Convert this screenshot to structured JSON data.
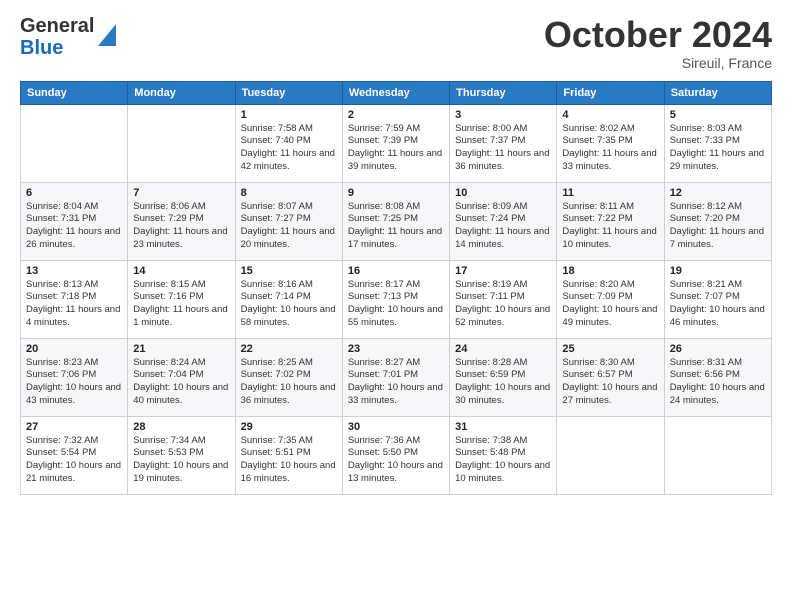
{
  "header": {
    "logo_line1": "General",
    "logo_line2": "Blue",
    "month": "October 2024",
    "location": "Sireuil, France"
  },
  "weekdays": [
    "Sunday",
    "Monday",
    "Tuesday",
    "Wednesday",
    "Thursday",
    "Friday",
    "Saturday"
  ],
  "weeks": [
    [
      {
        "day": "",
        "info": ""
      },
      {
        "day": "",
        "info": ""
      },
      {
        "day": "1",
        "info": "Sunrise: 7:58 AM\nSunset: 7:40 PM\nDaylight: 11 hours and 42 minutes."
      },
      {
        "day": "2",
        "info": "Sunrise: 7:59 AM\nSunset: 7:39 PM\nDaylight: 11 hours and 39 minutes."
      },
      {
        "day": "3",
        "info": "Sunrise: 8:00 AM\nSunset: 7:37 PM\nDaylight: 11 hours and 36 minutes."
      },
      {
        "day": "4",
        "info": "Sunrise: 8:02 AM\nSunset: 7:35 PM\nDaylight: 11 hours and 33 minutes."
      },
      {
        "day": "5",
        "info": "Sunrise: 8:03 AM\nSunset: 7:33 PM\nDaylight: 11 hours and 29 minutes."
      }
    ],
    [
      {
        "day": "6",
        "info": "Sunrise: 8:04 AM\nSunset: 7:31 PM\nDaylight: 11 hours and 26 minutes."
      },
      {
        "day": "7",
        "info": "Sunrise: 8:06 AM\nSunset: 7:29 PM\nDaylight: 11 hours and 23 minutes."
      },
      {
        "day": "8",
        "info": "Sunrise: 8:07 AM\nSunset: 7:27 PM\nDaylight: 11 hours and 20 minutes."
      },
      {
        "day": "9",
        "info": "Sunrise: 8:08 AM\nSunset: 7:25 PM\nDaylight: 11 hours and 17 minutes."
      },
      {
        "day": "10",
        "info": "Sunrise: 8:09 AM\nSunset: 7:24 PM\nDaylight: 11 hours and 14 minutes."
      },
      {
        "day": "11",
        "info": "Sunrise: 8:11 AM\nSunset: 7:22 PM\nDaylight: 11 hours and 10 minutes."
      },
      {
        "day": "12",
        "info": "Sunrise: 8:12 AM\nSunset: 7:20 PM\nDaylight: 11 hours and 7 minutes."
      }
    ],
    [
      {
        "day": "13",
        "info": "Sunrise: 8:13 AM\nSunset: 7:18 PM\nDaylight: 11 hours and 4 minutes."
      },
      {
        "day": "14",
        "info": "Sunrise: 8:15 AM\nSunset: 7:16 PM\nDaylight: 11 hours and 1 minute."
      },
      {
        "day": "15",
        "info": "Sunrise: 8:16 AM\nSunset: 7:14 PM\nDaylight: 10 hours and 58 minutes."
      },
      {
        "day": "16",
        "info": "Sunrise: 8:17 AM\nSunset: 7:13 PM\nDaylight: 10 hours and 55 minutes."
      },
      {
        "day": "17",
        "info": "Sunrise: 8:19 AM\nSunset: 7:11 PM\nDaylight: 10 hours and 52 minutes."
      },
      {
        "day": "18",
        "info": "Sunrise: 8:20 AM\nSunset: 7:09 PM\nDaylight: 10 hours and 49 minutes."
      },
      {
        "day": "19",
        "info": "Sunrise: 8:21 AM\nSunset: 7:07 PM\nDaylight: 10 hours and 46 minutes."
      }
    ],
    [
      {
        "day": "20",
        "info": "Sunrise: 8:23 AM\nSunset: 7:06 PM\nDaylight: 10 hours and 43 minutes."
      },
      {
        "day": "21",
        "info": "Sunrise: 8:24 AM\nSunset: 7:04 PM\nDaylight: 10 hours and 40 minutes."
      },
      {
        "day": "22",
        "info": "Sunrise: 8:25 AM\nSunset: 7:02 PM\nDaylight: 10 hours and 36 minutes."
      },
      {
        "day": "23",
        "info": "Sunrise: 8:27 AM\nSunset: 7:01 PM\nDaylight: 10 hours and 33 minutes."
      },
      {
        "day": "24",
        "info": "Sunrise: 8:28 AM\nSunset: 6:59 PM\nDaylight: 10 hours and 30 minutes."
      },
      {
        "day": "25",
        "info": "Sunrise: 8:30 AM\nSunset: 6:57 PM\nDaylight: 10 hours and 27 minutes."
      },
      {
        "day": "26",
        "info": "Sunrise: 8:31 AM\nSunset: 6:56 PM\nDaylight: 10 hours and 24 minutes."
      }
    ],
    [
      {
        "day": "27",
        "info": "Sunrise: 7:32 AM\nSunset: 5:54 PM\nDaylight: 10 hours and 21 minutes."
      },
      {
        "day": "28",
        "info": "Sunrise: 7:34 AM\nSunset: 5:53 PM\nDaylight: 10 hours and 19 minutes."
      },
      {
        "day": "29",
        "info": "Sunrise: 7:35 AM\nSunset: 5:51 PM\nDaylight: 10 hours and 16 minutes."
      },
      {
        "day": "30",
        "info": "Sunrise: 7:36 AM\nSunset: 5:50 PM\nDaylight: 10 hours and 13 minutes."
      },
      {
        "day": "31",
        "info": "Sunrise: 7:38 AM\nSunset: 5:48 PM\nDaylight: 10 hours and 10 minutes."
      },
      {
        "day": "",
        "info": ""
      },
      {
        "day": "",
        "info": ""
      }
    ]
  ]
}
